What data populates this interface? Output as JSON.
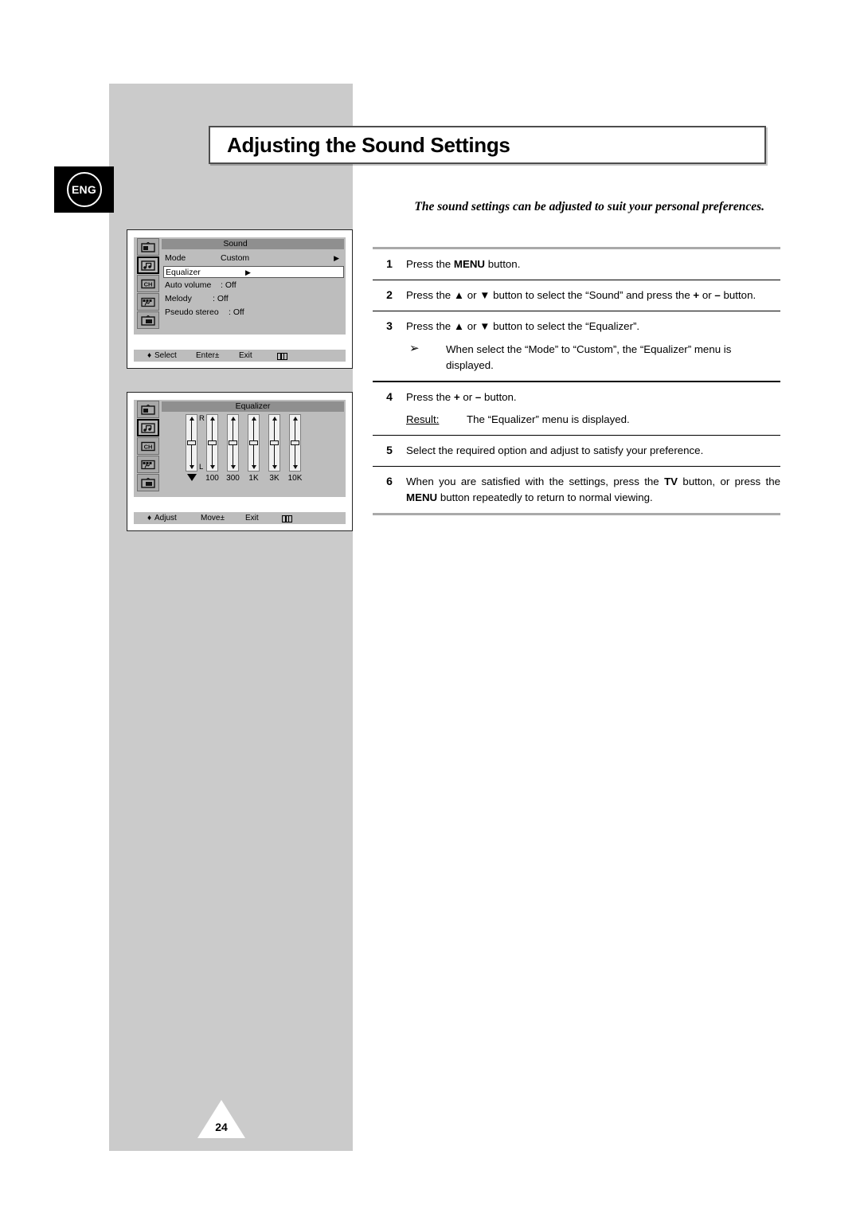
{
  "language_badge": "ENG",
  "page_title": "Adjusting the Sound Settings",
  "intro": "The sound settings can be adjusted to suit your personal preferences.",
  "page_number": "24",
  "osd_sound": {
    "title": "Sound",
    "rows": [
      {
        "label": "Mode",
        "value": "Custom",
        "arrow": "▶",
        "highlighted": false
      },
      {
        "label": "Equalizer",
        "value": "",
        "arrow": "▶",
        "highlighted": true
      },
      {
        "label": "Auto volume",
        "value": ": Off",
        "arrow": "",
        "highlighted": false
      },
      {
        "label": "Melody",
        "value": ": Off",
        "arrow": "",
        "highlighted": false
      },
      {
        "label": "Pseudo stereo",
        "value": ": Off",
        "arrow": "",
        "highlighted": false
      }
    ],
    "footer": {
      "nav_glyph": "♦",
      "nav_label": "Select",
      "enter_label": "Enter±",
      "exit_label": "Exit"
    },
    "sidebar_icons": [
      "picture-icon",
      "sound-icon",
      "channel-icon",
      "setup-icon",
      "pip-icon"
    ],
    "selected_sidebar_icon": "sound-icon"
  },
  "osd_equalizer": {
    "title": "Equalizer",
    "footer": {
      "nav_glyph": "♦",
      "nav_label": "Adjust",
      "enter_label": "Move±",
      "exit_label": "Exit"
    },
    "channel_top": "R",
    "channel_bottom": "L",
    "bands": [
      {
        "label": "",
        "icon": "balance-icon"
      },
      {
        "label": "100",
        "icon": ""
      },
      {
        "label": "300",
        "icon": ""
      },
      {
        "label": "1K",
        "icon": ""
      },
      {
        "label": "3K",
        "icon": ""
      },
      {
        "label": "10K",
        "icon": ""
      }
    ],
    "sidebar_icons": [
      "picture-icon",
      "sound-icon",
      "channel-icon",
      "setup-icon",
      "pip-icon"
    ],
    "selected_sidebar_icon": "sound-icon"
  },
  "steps": [
    {
      "num": "1",
      "parts": [
        {
          "t": "Press the ",
          "b": false
        },
        {
          "t": "MENU",
          "b": true
        },
        {
          "t": " button.",
          "b": false
        }
      ]
    },
    {
      "num": "2",
      "parts": [
        {
          "t": "Press the ▲ or ▼ button to select the “Sound” and press the ",
          "b": false
        },
        {
          "t": "+",
          "b": true
        },
        {
          "t": " or ",
          "b": false
        },
        {
          "t": "–",
          "b": true
        },
        {
          "t": " button.",
          "b": false
        }
      ]
    },
    {
      "num": "3",
      "parts": [
        {
          "t": "Press the ▲ or ▼ button to select the “Equalizer”.",
          "b": false
        }
      ],
      "note": "When select the “Mode” to “Custom”, the “Equalizer” menu is displayed."
    },
    {
      "num": "4",
      "parts": [
        {
          "t": "Press the ",
          "b": false
        },
        {
          "t": "+",
          "b": true
        },
        {
          "t": " or ",
          "b": false
        },
        {
          "t": "–",
          "b": true
        },
        {
          "t": " button.",
          "b": false
        }
      ],
      "result_label": "Result:",
      "result_text": "The “Equalizer” menu is displayed."
    },
    {
      "num": "5",
      "parts": [
        {
          "t": "Select the required option and adjust to satisfy your preference.",
          "b": false
        }
      ]
    },
    {
      "num": "6",
      "parts": [
        {
          "t": "When you are satisfied with the settings, press the ",
          "b": false
        },
        {
          "t": "TV",
          "b": true
        },
        {
          "t": " button, or press the ",
          "b": false
        },
        {
          "t": "MENU",
          "b": true
        },
        {
          "t": " button repeatedly to return to normal viewing.",
          "b": false
        }
      ]
    }
  ]
}
